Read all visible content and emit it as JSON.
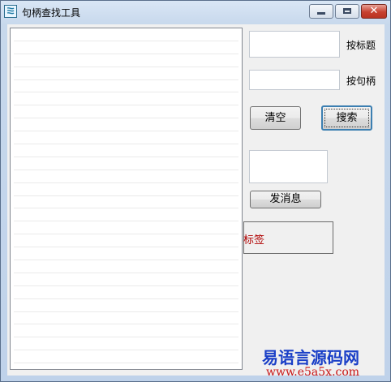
{
  "window": {
    "title": "句柄查找工具",
    "icon": "app-icon",
    "minimize_icon": "minimize-icon",
    "maximize_icon": "maximize-icon",
    "close_icon": "close-icon",
    "close_glyph": "✕"
  },
  "listbox": {
    "rows": [
      "",
      "",
      "",
      "",
      "",
      "",
      "",
      "",
      "",
      "",
      "",
      "",
      "",
      "",
      "",
      "",
      "",
      "",
      "",
      "",
      "",
      "",
      "",
      "",
      "",
      ""
    ]
  },
  "form": {
    "title_input_value": "",
    "title_label": "按标题",
    "handle_input_value": "",
    "handle_label": "按句柄",
    "clear_button": "清空",
    "search_button": "搜索",
    "message_input_value": "",
    "send_button": "发消息",
    "tag_label": "标签"
  },
  "watermark": {
    "line1": "易语言源码网",
    "line2": "www.e5a5x.com"
  }
}
